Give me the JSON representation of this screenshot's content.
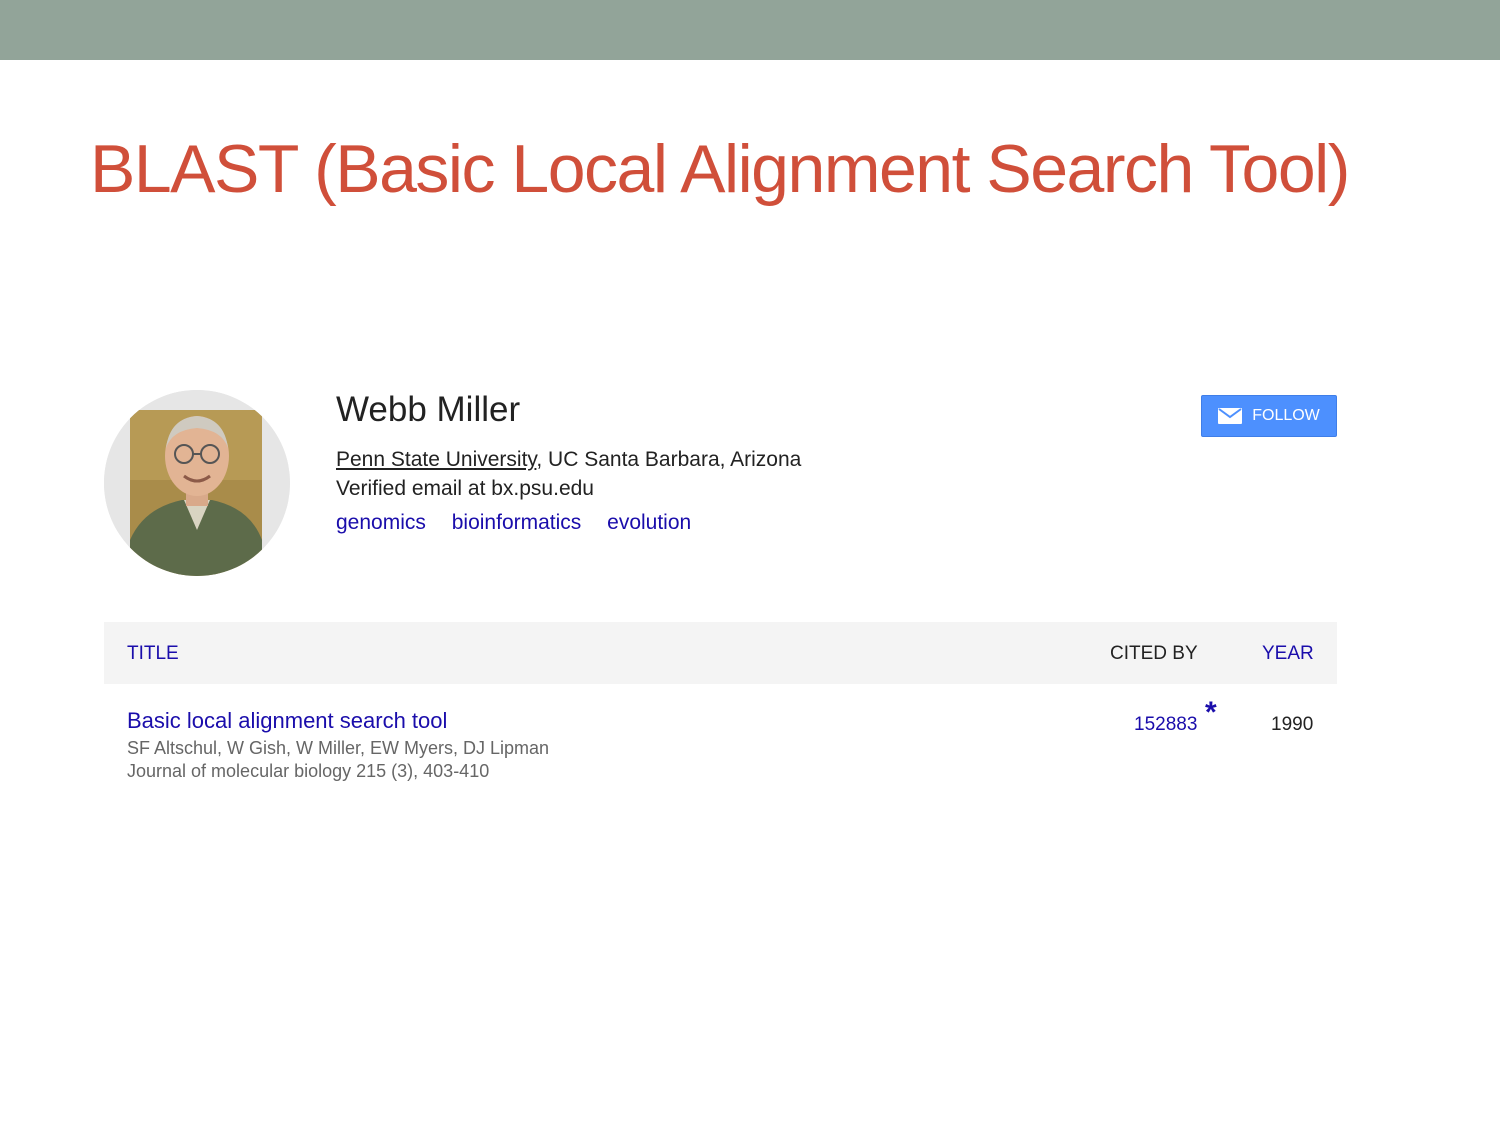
{
  "slide": {
    "title": "BLAST (Basic Local Alignment Search Tool)",
    "accent_color": "#d04f3a",
    "bar_color": "#92a499"
  },
  "profile": {
    "name": "Webb Miller",
    "affiliation_link": "Penn State University",
    "affiliation_rest": ", UC Santa Barbara, Arizona",
    "email": "Verified email at bx.psu.edu",
    "interests": [
      "genomics",
      "bioinformatics",
      "evolution"
    ],
    "follow_label": "FOLLOW",
    "follow_icon": "mail-icon"
  },
  "table": {
    "headers": {
      "title": "TITLE",
      "cited_by": "CITED BY",
      "year": "YEAR"
    },
    "rows": [
      {
        "title": "Basic local alignment search tool",
        "authors": "SF Altschul, W Gish, W Miller, EW Myers, DJ Lipman",
        "venue": "Journal of molecular biology 215 (3), 403-410",
        "cited_by": "152883",
        "marker": "*",
        "year": "1990"
      }
    ]
  },
  "colors": {
    "link": "#1a0dab",
    "button": "#4d90fe"
  }
}
